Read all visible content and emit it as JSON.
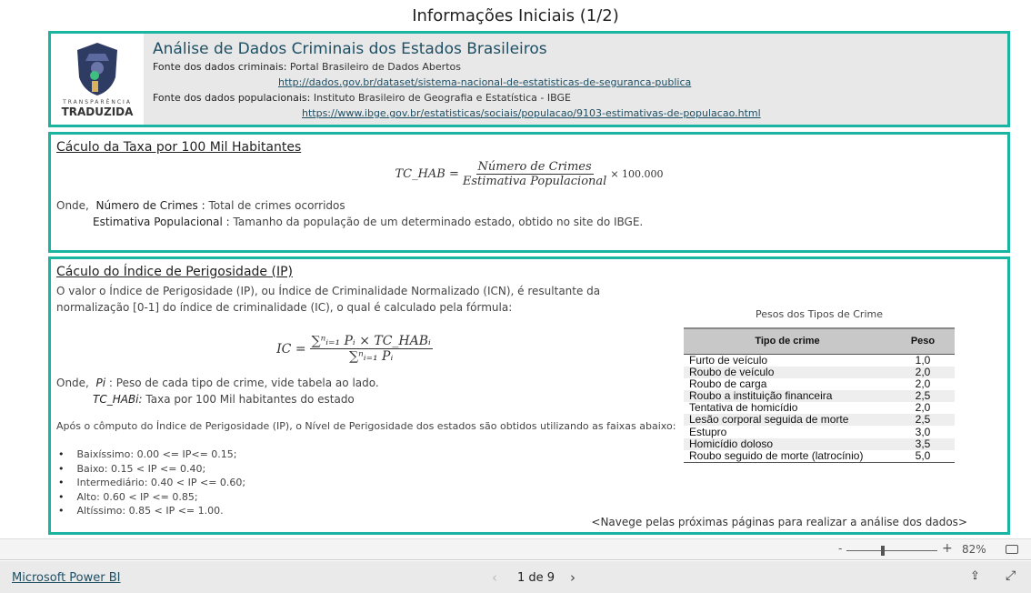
{
  "page_title": "Informações Iniciais (1/2)",
  "header": {
    "logo_top": "TRANSPARÊNCIA",
    "logo_bottom": "TRADUZIDA",
    "title": "Análise de Dados Criminais dos Estados Brasileiros",
    "crime_label": "Fonte dos dados criminais:",
    "crime_source": "Portal Brasileiro de Dados Abertos",
    "crime_url": "http://dados.gov.br/dataset/sistema-nacional-de-estatisticas-de-seguranca-publica",
    "pop_label": "Fonte dos dados populacionais:",
    "pop_source": "Instituto Brasileiro de Geografia e Estatística - IBGE",
    "pop_url": "https://www.ibge.gov.br/estatisticas/sociais/populacao/9103-estimativas-de-populacao.html"
  },
  "taxa": {
    "title": "Cáculo da Taxa por 100 Mil Habitantes",
    "lhs": "TC_HAB =",
    "num": "Número de Crimes",
    "den": "Estimativa Populacional",
    "mult": "× 100.000",
    "onde": "Onde,",
    "t1": "Número de Crimes :",
    "d1": "Total de crimes ocorridos",
    "t2": "Estimativa Populacional :",
    "d2": "Tamanho da população de um determinado estado, obtido no site do IBGE."
  },
  "ip": {
    "title": "Cáculo do Índice de Perigosidade (IP)",
    "p1": "O valor o Índice de Perigosidade (IP), ou Índice de Criminalidade Normalizado (ICN), é resultante da normalização [0-1] do índice de criminalidade (IC), o qual é calculado pela fórmula:",
    "lhs": "IC =",
    "num": "∑ⁿᵢ₌₁ Pᵢ × TC_HABᵢ",
    "den": "∑ⁿᵢ₌₁ Pᵢ",
    "onde": "Onde,",
    "t1": "Pi",
    "d1": ": Peso de cada tipo de crime, vide tabela ao lado.",
    "t2": "TC_HABi:",
    "d2": "Taxa por 100 Mil habitantes do estado",
    "p2": "Após o cômputo do Índice de Perigosidade (IP), o Nível de Perigosidade dos estados são obtidos utilizando as faixas abaixo:",
    "ranges": [
      "Baixíssimo: 0.00 <= IP<= 0.15;",
      "Baixo: 0.15 < IP <= 0.40;",
      "Intermediário: 0.40 < IP <= 0.60;",
      "Alto: 0.60 < IP <= 0.85;",
      "Altíssimo: 0.85 < IP <= 1.00."
    ],
    "nav_hint": "<Navege pelas próximas páginas para realizar a análise dos dados>"
  },
  "table": {
    "caption": "Pesos dos Tipos de Crime",
    "headers": [
      "Tipo de crime",
      "Peso"
    ],
    "rows": [
      [
        "Furto de veículo",
        "1,0"
      ],
      [
        "Roubo de veículo",
        "2,0"
      ],
      [
        "Roubo de carga",
        "2,0"
      ],
      [
        "Roubo a instituição financeira",
        "2,5"
      ],
      [
        "Tentativa de homicídio",
        "2,0"
      ],
      [
        "Lesão corporal seguida de morte",
        "2,5"
      ],
      [
        "Estupro",
        "3,0"
      ],
      [
        "Homicídio doloso",
        "3,5"
      ],
      [
        "Roubo seguido de morte (latrocínio)",
        "5,0"
      ]
    ]
  },
  "zoom": {
    "minus": "-",
    "plus": "+",
    "level": "82%",
    "value_percent": 82
  },
  "footer": {
    "brand": "Microsoft Power BI",
    "page": "1 de 9"
  },
  "colors": {
    "accent": "#1ab5a0",
    "link": "#1e4f64"
  }
}
